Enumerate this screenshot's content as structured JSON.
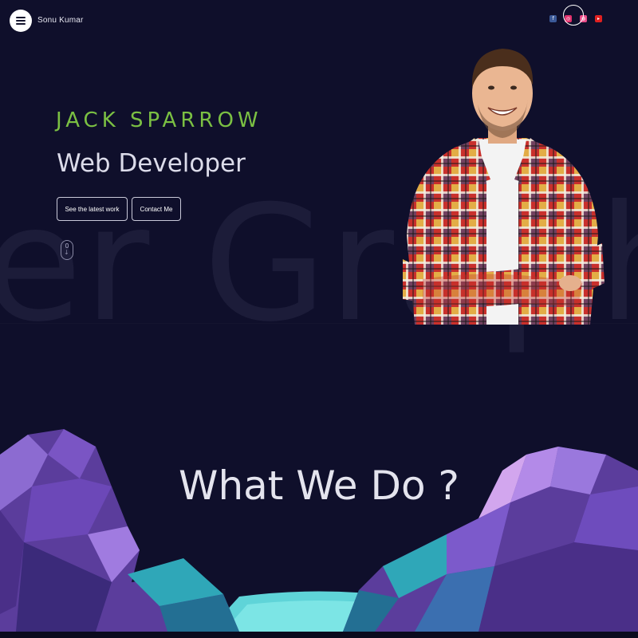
{
  "header": {
    "brand": "Sonu Kumar",
    "menu_icon": "hamburger-icon",
    "socials": [
      {
        "name": "facebook-icon",
        "color": "#3b5998",
        "glyph": "f"
      },
      {
        "name": "instagram-icon",
        "color": "#e1306c",
        "glyph": "◎"
      },
      {
        "name": "dribbble-icon",
        "color": "#ea4c89",
        "glyph": "◍"
      },
      {
        "name": "youtube-icon",
        "color": "#e02020",
        "glyph": "▸"
      }
    ]
  },
  "hero": {
    "name": "JACK SPARROW",
    "role": "Web Developer",
    "background_word": "er Graph",
    "buttons": {
      "work": "See the latest work",
      "contact": "Contact Me"
    },
    "scroll_icon": "mouse-scroll-icon"
  },
  "section": {
    "title": "What We Do ?"
  },
  "colors": {
    "background": "#0f0f2b",
    "accent_green": "#7bc043",
    "text_light": "#dcdcea"
  }
}
